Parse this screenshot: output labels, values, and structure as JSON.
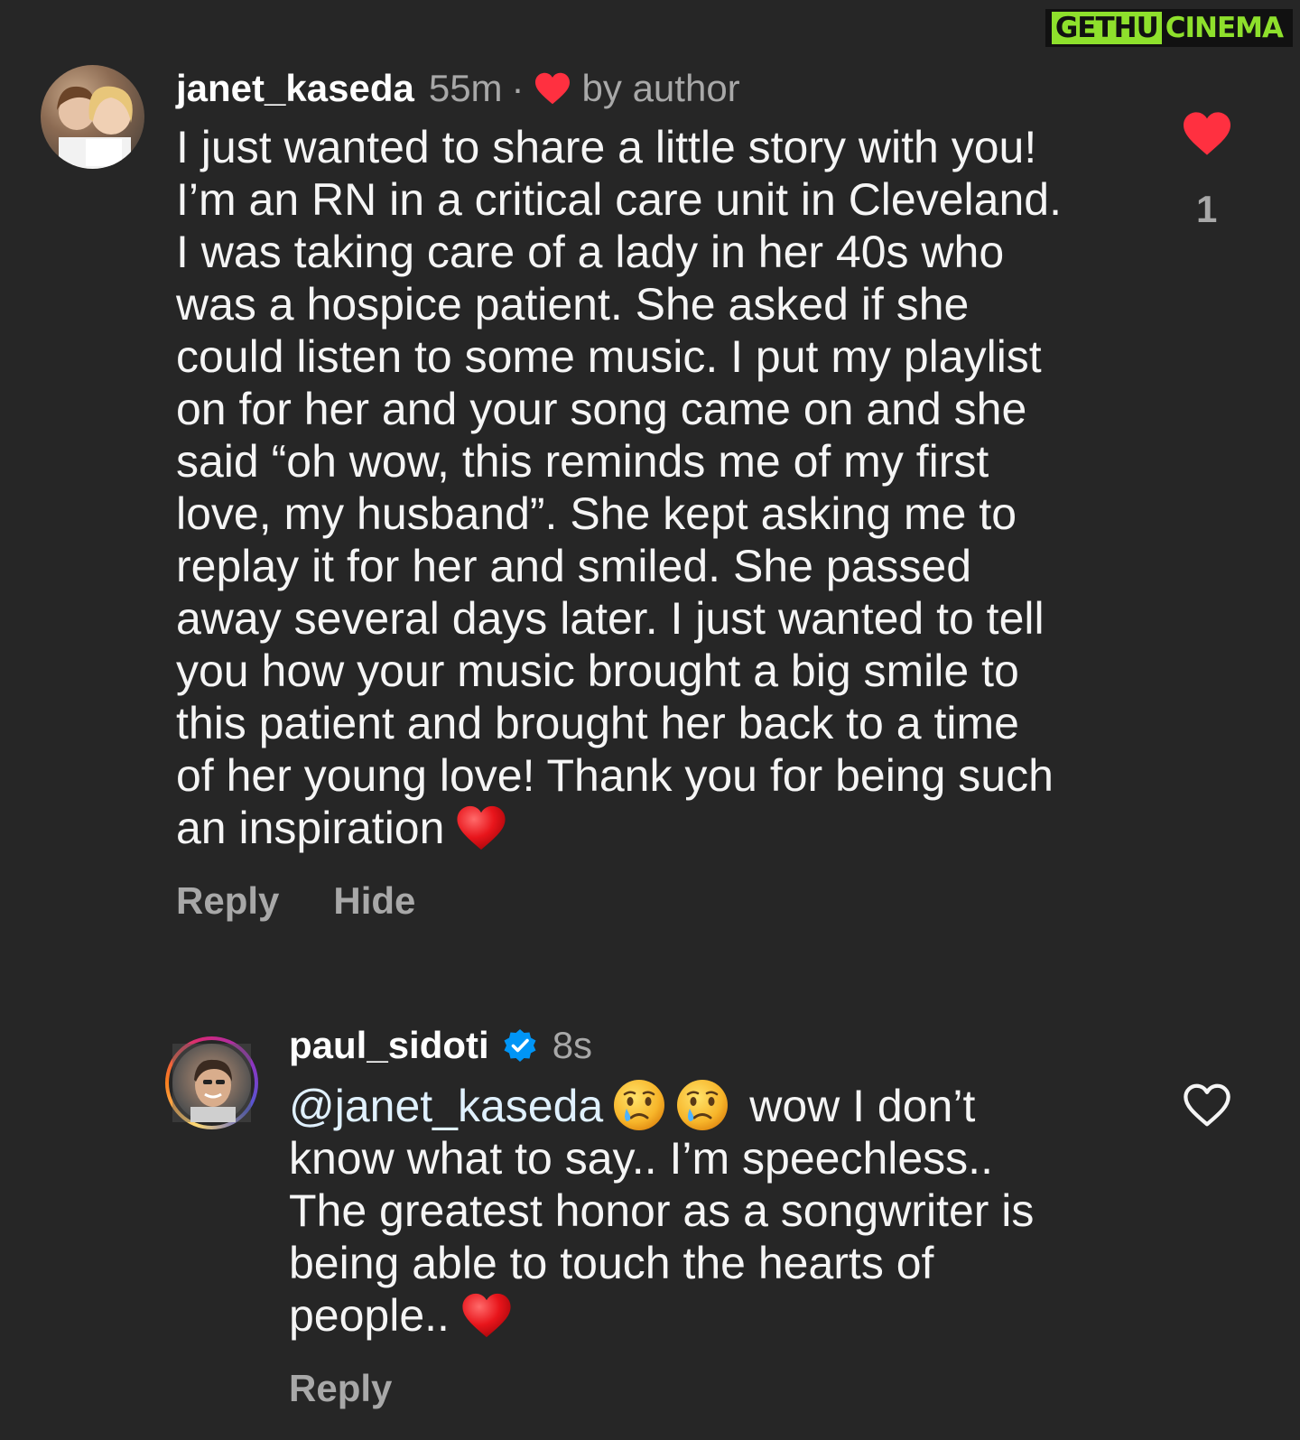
{
  "watermark": {
    "part_a": "GETHU",
    "part_b": "CINEMA"
  },
  "comments": [
    {
      "username": "janet_kaseda",
      "time": "55m",
      "separator": "·",
      "by_author": "by author",
      "text": "I just wanted to share a little story with you!\nI’m an RN in a critical care unit in Cleveland.\nI was taking care of a lady in her 40s who\nwas a hospice patient. She asked if she\ncould listen to some music. I put my playlist\non for her and your song came on and she\nsaid “oh wow, this reminds me of my first\nlove, my husband”. She kept asking me to\nreplay it for her and smiled. She passed\naway several days later. I just wanted to tell\nyou how your music brought a big smile to\nthis patient and brought her back to a time\nof her young love! Thank you for being such\nan inspiration",
      "actions": {
        "reply": "Reply",
        "hide": "Hide"
      },
      "like_count": "1",
      "liked": true
    },
    {
      "username": "paul_sidoti",
      "verified": true,
      "time": "8s",
      "mention": "@janet_kaseda",
      "text_line1": "wow I don’t",
      "text_rest": "know what to say.. I’m speechless..\nThe greatest honor as a songwriter is\nbeing able to touch the hearts of\npeople..",
      "actions": {
        "reply": "Reply"
      },
      "liked": false
    }
  ],
  "icons": {
    "heart_filled": "heart-filled-icon",
    "heart_outline": "heart-outline-icon",
    "verified": "verified-badge-icon",
    "emoji_heart": "red-heart-emoji",
    "emoji_cry": "crying-face-emoji"
  },
  "colors": {
    "background": "#262626",
    "heart_red": "#ff3040",
    "secondary_text": "#a8a8a8",
    "verified_blue": "#0095f6"
  }
}
